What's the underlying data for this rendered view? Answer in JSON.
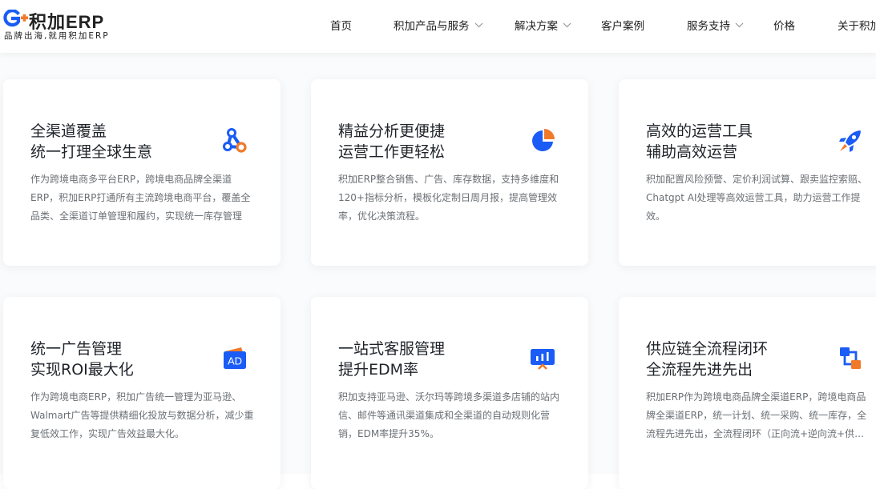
{
  "header": {
    "brand": "积加ERP",
    "slogan": "品牌出海,就用积加ERP",
    "nav": [
      {
        "label": "首页",
        "has_dropdown": false
      },
      {
        "label": "积加产品与服务",
        "has_dropdown": true
      },
      {
        "label": "解决方案",
        "has_dropdown": true
      },
      {
        "label": "客户案例",
        "has_dropdown": false
      },
      {
        "label": "服务支持",
        "has_dropdown": true
      },
      {
        "label": "价格",
        "has_dropdown": false
      },
      {
        "label": "关于积加",
        "has_dropdown": false
      }
    ]
  },
  "colors": {
    "brand_blue": "#1a5cf5",
    "accent_orange": "#f07a2a",
    "text_dark": "#1f2329",
    "text_muted": "#6b7075"
  },
  "features": [
    {
      "title_line1": "全渠道覆盖",
      "title_line2": "统一打理全球生意",
      "icon": "channels-network-icon",
      "desc": "作为跨境电商多平台ERP，跨境电商品牌全渠道ERP，积加ERP打通所有主流跨境电商平台，覆盖全品类、全渠道订单管理和履约，实现统一库存管理"
    },
    {
      "title_line1": "精益分析更便捷",
      "title_line2": "运营工作更轻松",
      "icon": "pie-chart-icon",
      "desc": "积加ERP整合销售、广告、库存数据，支持多维度和120+指标分析，模板化定制日周月报，提高管理效率，优化决策流程。"
    },
    {
      "title_line1": "高效的运营工具",
      "title_line2": "辅助高效运营",
      "icon": "rocket-icon",
      "desc": "积加配置风险预警、定价利润试算、跟卖监控索赔、Chatgpt AI处理等高效运营工具，助力运营工作提效。"
    },
    {
      "title_line1": "统一广告管理",
      "title_line2": "实现ROI最大化",
      "icon": "ad-wallet-icon",
      "icon_text": "AD",
      "desc": "作为跨境电商ERP，积加广告统一管理为亚马逊、Walmart广告等提供精细化投放与数据分析，减少重复低效工作，实现广告效益最大化。"
    },
    {
      "title_line1": "一站式客服管理",
      "title_line2": "提升EDM率",
      "icon": "presentation-board-icon",
      "desc": "积加支持亚马逊、沃尔玛等跨境多渠道多店铺的站内信、邮件等通讯渠道集成和全渠道的自动规则化营销，EDM率提升35%。"
    },
    {
      "title_line1": "供应链全流程闭环",
      "title_line2": "全流程先进先出",
      "icon": "supply-chain-flow-icon",
      "desc": "积加ERP作为跨境电商品牌全渠道ERP，跨境电商品牌全渠道ERP，统一计划、统一采购、统一库存，全流程先进先出，全流程闭环（正向流+逆向流+供应链全链路）"
    }
  ]
}
